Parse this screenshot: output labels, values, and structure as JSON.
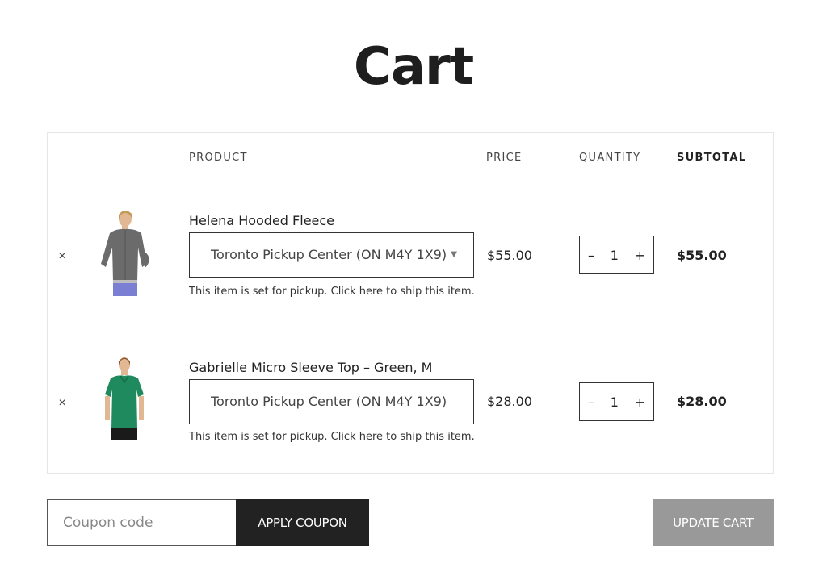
{
  "page": {
    "title": "Cart"
  },
  "table": {
    "headers": {
      "product": "PRODUCT",
      "price": "PRICE",
      "quantity": "QUANTITY",
      "subtotal": "SUBTOTAL"
    },
    "rows": [
      {
        "remove": "×",
        "name": "Helena Hooded Fleece",
        "pickup_location": "Toronto Pickup Center (ON M4Y 1X9)",
        "pickup_caret": "▼",
        "note": "This item is set for pickup. Click here to ship this item.",
        "price": "$55.00",
        "qty_minus": "–",
        "quantity": "1",
        "qty_plus": "+",
        "subtotal": "$55.00",
        "image_icon": "gray-hoodie-product-photo"
      },
      {
        "remove": "×",
        "name": "Gabrielle Micro Sleeve Top – Green, M",
        "pickup_location": "Toronto Pickup Center (ON M4Y 1X9)",
        "note": "This item is set for pickup. Click here to ship this item.",
        "price": "$28.00",
        "qty_minus": "–",
        "quantity": "1",
        "qty_plus": "+",
        "subtotal": "$28.00",
        "image_icon": "green-top-product-photo"
      }
    ]
  },
  "actions": {
    "coupon_placeholder": "Coupon code",
    "apply_coupon": "APPLY COUPON",
    "update_cart": "UPDATE CART"
  },
  "colors": {
    "dark_button": "#222222",
    "disabled_button": "#999999",
    "hoodie": "#6b6b6b",
    "top": "#1e8a5e"
  }
}
